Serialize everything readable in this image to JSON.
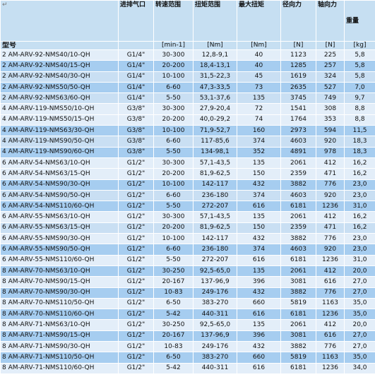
{
  "columns": [
    {
      "key": "model",
      "label": "",
      "unit": "型号"
    },
    {
      "key": "port",
      "label": "进排气口",
      "unit": ""
    },
    {
      "key": "speed",
      "label": "转速范围",
      "unit": "[min-1]"
    },
    {
      "key": "torque_range",
      "label": "扭矩范围",
      "unit": "[Nm]"
    },
    {
      "key": "max_torque",
      "label": "最大扭矩",
      "unit": "[Nm]"
    },
    {
      "key": "radial",
      "label": "径向力",
      "unit": "[N]"
    },
    {
      "key": "axial",
      "label": "轴向力",
      "unit": "[N]"
    },
    {
      "key": "weight",
      "label": "重量",
      "unit": "[kg]"
    }
  ],
  "rows": [
    [
      "2 AM-ARV-92-NMS40/10-QH",
      "G1/4\"",
      "30-300",
      "12,8-9,1",
      "40",
      "1123",
      "225",
      "5,8",
      "light"
    ],
    [
      "2 AM-ARV-92-NMS40/15-QH",
      "G1/4\"",
      "20-200",
      "18,4-13,1",
      "40",
      "1285",
      "257",
      "5,8",
      "blue"
    ],
    [
      "2 AM-ARV-92-NMS40/30-QH",
      "G1/4\"",
      "10-100",
      "31,5-22,3",
      "45",
      "1619",
      "324",
      "5,8",
      "mid"
    ],
    [
      "2 AM-ARV-92-NMS50/50-QH",
      "G1/4\"",
      "6-60",
      "47,3-33,5",
      "73",
      "2635",
      "527",
      "7,0",
      "blue"
    ],
    [
      "2 AM-ARV-92-NMS63/60-QH",
      "G1/4\"",
      "5-50",
      "53,1-37,6",
      "135",
      "3745",
      "749",
      "9,7",
      "mid"
    ],
    [
      "4 AM-ARV-119-NMS50/10-QH",
      "G3/8\"",
      "30-300",
      "27,9-20,4",
      "72",
      "1541",
      "308",
      "8,8",
      "light"
    ],
    [
      "4 AM-ARV-119-NMS50/15-QH",
      "G3/8\"",
      "20-200",
      "40,0-29,2",
      "74",
      "1764",
      "353",
      "8,8",
      "light"
    ],
    [
      "4 AM-ARV-119-NMS63/30-QH",
      "G3/8\"",
      "10-100",
      "71,9-52,7",
      "160",
      "2973",
      "594",
      "11,5",
      "blue"
    ],
    [
      "4 AM-ARV-119-NMS90/50-QH",
      "G3/8\"",
      "6-60",
      "117-85,6",
      "374",
      "4603",
      "920",
      "18,3",
      "mid"
    ],
    [
      "4 AM-ARV-119-NMS90/60-QH",
      "G3/8\"",
      "5-50",
      "134-98,1",
      "352",
      "4891",
      "978",
      "18,3",
      "blue"
    ],
    [
      "6 AM-ARV-54-NMS63/10-QH",
      "G1/2\"",
      "30-300",
      "57,1-43,5",
      "135",
      "2061",
      "412",
      "16,2",
      "light"
    ],
    [
      "6 AM-ARV-54-NMS63/15-QH",
      "G1/2\"",
      "20-200",
      "81,9-62,5",
      "150",
      "2359",
      "471",
      "16,2",
      "light"
    ],
    [
      "6 AM-ARV-54-NMS90/30-QH",
      "G1/2\"",
      "10-100",
      "142-117",
      "432",
      "3882",
      "776",
      "23,0",
      "blue"
    ],
    [
      "6 AM-ARV-54-NMS90/50-QH",
      "G1/2\"",
      "6-60",
      "236-180",
      "374",
      "4603",
      "920",
      "23,0",
      "mid"
    ],
    [
      "6 AM-ARV-54-NMS110/60-QH",
      "G1/2\"",
      "5-50",
      "272-207",
      "616",
      "6181",
      "1236",
      "31,0",
      "blue"
    ],
    [
      "6 AM-ARV-55-NMS63/10-QH",
      "G1/2\"",
      "30-300",
      "57,1-43,5",
      "135",
      "2061",
      "412",
      "16,2",
      "light"
    ],
    [
      "6 AM-ARV-55-NMS63/15-QH",
      "G1/2\"",
      "20-200",
      "81,9-62,5",
      "150",
      "2359",
      "471",
      "16,2",
      "mid"
    ],
    [
      "6 AM-ARV-55-NMS90/30-QH",
      "G1/2\"",
      "10-100",
      "142-117",
      "432",
      "3882",
      "776",
      "23,0",
      "light"
    ],
    [
      "6 AM-ARV-55-NMS90/50-QH",
      "G1/2\"",
      "6-60",
      "236-180",
      "374",
      "4603",
      "920",
      "23,0",
      "blue"
    ],
    [
      "6 AM-ARV-55-NMS110/60-QH",
      "G1/2\"",
      "5-50",
      "272-207",
      "616",
      "6181",
      "1236",
      "31,0",
      "light"
    ],
    [
      "8 AM-ARV-70-NMS63/10-QH",
      "G1/2\"",
      "30-250",
      "92,5-65,0",
      "135",
      "2061",
      "412",
      "20,0",
      "blue"
    ],
    [
      "8 AM-ARV-70-NMS90/15-QH",
      "G1/2\"",
      "20-167",
      "137-96,9",
      "396",
      "3081",
      "616",
      "27,0",
      "light"
    ],
    [
      "8 AM-ARV-70-NMS90/30-QH",
      "G1/2\"",
      "10-83",
      "249-176",
      "432",
      "3882",
      "776",
      "27,0",
      "blue"
    ],
    [
      "8 AM-ARV-70-NMS110/50-QH",
      "G1/2\"",
      "6-50",
      "383-270",
      "660",
      "5819",
      "1163",
      "35,0",
      "light"
    ],
    [
      "8 AM-ARV-70-NMS110/60-QH",
      "G1/2\"",
      "5-42",
      "440-311",
      "616",
      "6181",
      "1236",
      "35,0",
      "blue"
    ],
    [
      "8 AM-ARV-71-NMS63/10-QH",
      "G1/2\"",
      "30-250",
      "92,5-65,0",
      "135",
      "2061",
      "412",
      "20,0",
      "light"
    ],
    [
      "8 AM-ARV-71-NMS90/15-QH",
      "G1/2\"",
      "20-167",
      "137-96,9",
      "396",
      "3081",
      "616",
      "27,0",
      "blue"
    ],
    [
      "8 AM-ARV-71-NMS90/30-QH",
      "G1/2\"",
      "10-83",
      "249-176",
      "432",
      "3882",
      "776",
      "27,0",
      "light"
    ],
    [
      "8 AM-ARV-71-NMS110/50-QH",
      "G1/2\"",
      "6-50",
      "383-270",
      "660",
      "5819",
      "1163",
      "35,0",
      "blue"
    ],
    [
      "8 AM-ARV-71-NMS110/60-QH",
      "G1/2\"",
      "5-42",
      "440-311",
      "616",
      "6181",
      "1236",
      "34,0",
      "light"
    ]
  ],
  "colors": {
    "header": "#c6dff2",
    "light": "#e3eef9",
    "mid": "#c9dff3",
    "blue": "#a6cdf0"
  }
}
